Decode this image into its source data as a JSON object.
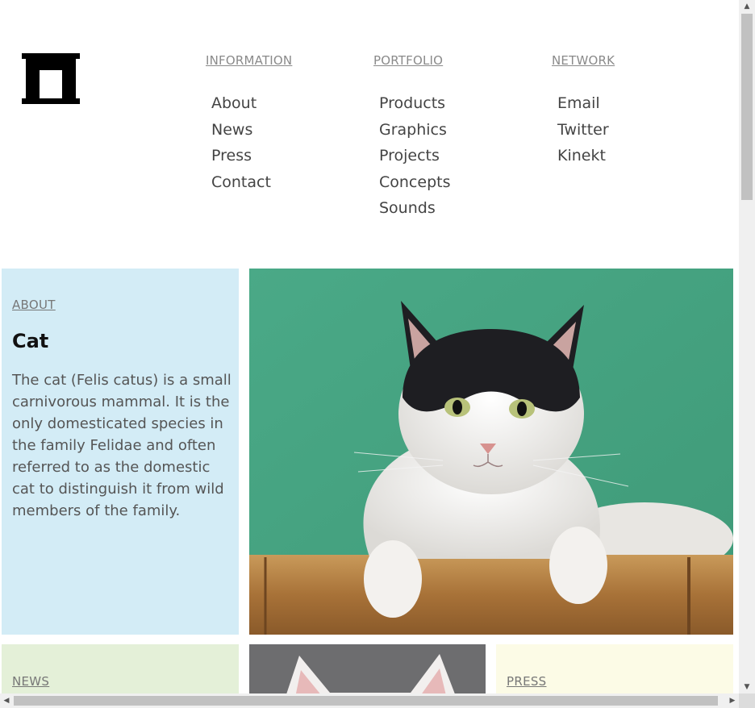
{
  "nav": {
    "information": {
      "heading": "INFORMATION",
      "links": [
        "About",
        "News",
        "Press",
        "Contact"
      ]
    },
    "portfolio": {
      "heading": "PORTFOLIO",
      "links": [
        "Products",
        "Graphics",
        "Projects",
        "Concepts",
        "Sounds"
      ]
    },
    "network": {
      "heading": "NETWORK",
      "links": [
        "Email",
        "Twitter",
        "Kinekt"
      ]
    }
  },
  "about": {
    "heading": "ABOUT",
    "title": "Cat",
    "text": "The cat (Felis catus) is a small carnivorous mammal. It is the only domesticated species in the family Felidae and often referred to as the domestic cat to distinguish it from wild members of the family."
  },
  "news": {
    "heading": "NEWS"
  },
  "press": {
    "heading": "PRESS"
  },
  "colors": {
    "about_bg": "#d3ecf6",
    "news_bg": "#e4f0d8",
    "press_bg": "#fcfbe6",
    "photo_bg": "#4bab83"
  },
  "icons": {
    "logo": "arch-logo-icon",
    "scroll_up": "triangle-up-icon",
    "scroll_down": "triangle-down-icon",
    "scroll_left": "triangle-left-icon",
    "scroll_right": "triangle-right-icon"
  }
}
